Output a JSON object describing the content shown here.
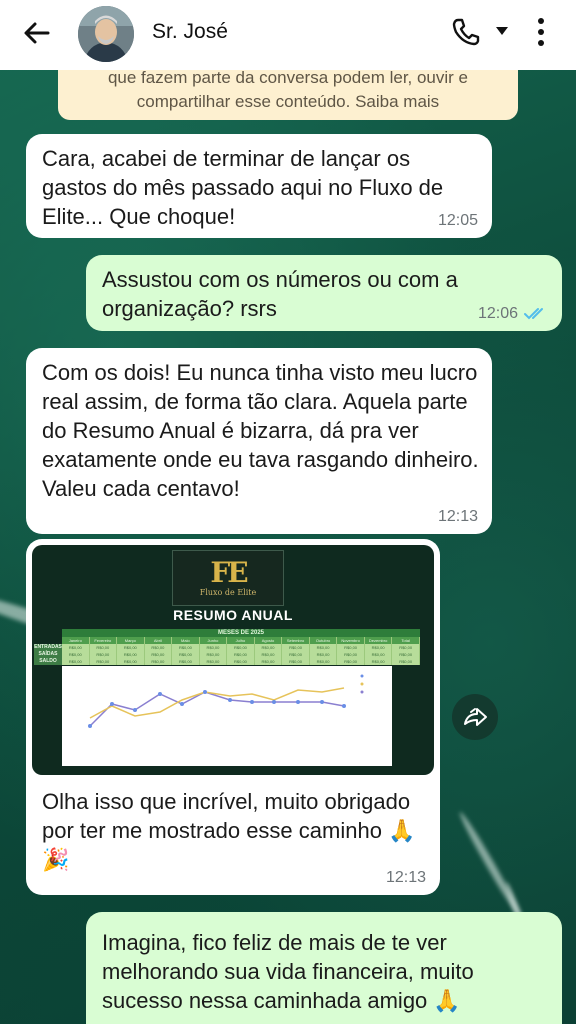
{
  "header": {
    "contact_name": "Sr. José"
  },
  "notice": {
    "line1": "que fazem parte da conversa podem ler, ouvir e",
    "line2": "compartilhar esse conteúdo. Saiba mais"
  },
  "messages": [
    {
      "direction": "in",
      "text": "Cara, acabei de terminar de lançar os gastos do mês passado aqui no Fluxo de Elite... Que choque!",
      "time": "12:05"
    },
    {
      "direction": "out",
      "text": "Assustou com os números ou com a organização? rsrs",
      "time": "12:06",
      "status": "read"
    },
    {
      "direction": "in",
      "text": "Com os dois! Eu nunca tinha visto meu lucro real assim, de forma tão clara. Aquela parte do Resumo Anual é bizarra, dá pra ver exatamente onde eu tava rasgando dinheiro. Valeu cada centavo!",
      "time": "12:13"
    },
    {
      "direction": "in",
      "text": "Olha isso que incrível, muito obrigado por ter me mostrado esse caminho 🙏🎉",
      "time": "12:13"
    },
    {
      "direction": "out",
      "text": "Imagina, fico feliz de mais de te ver melhorando sua vida financeira, muito sucesso nessa caminhada amigo 🙏",
      "time": ""
    }
  ],
  "image_card": {
    "logo_text": "Fluxo de Elite",
    "logo_mark": "FE",
    "title": "RESUMO ANUAL",
    "months_header": "MESES DE 2025",
    "row_labels": [
      "ENTRADAS",
      "SAÍDAS",
      "SALDO"
    ],
    "columns": [
      "Janeiro",
      "Fevereiro",
      "Março",
      "Abril",
      "Maio",
      "Junho",
      "Julho",
      "Agosto",
      "Setembro",
      "Outubro",
      "Novembro",
      "Dezembro",
      "Total"
    ],
    "cell_value": "R$0,00"
  },
  "colors": {
    "bubble_in": "#ffffff",
    "bubble_out": "#d9fdd3",
    "read_ticks": "#53bdeb",
    "notice_bg": "#fdf0d0"
  }
}
